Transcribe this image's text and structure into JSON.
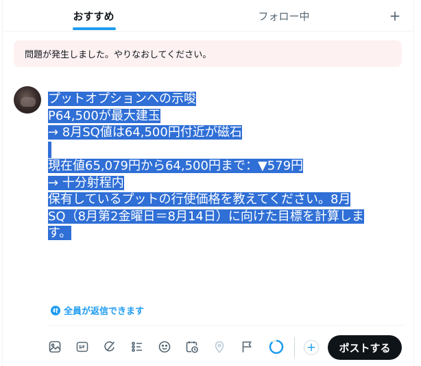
{
  "tabs": {
    "recommended": "おすすめ",
    "following": "フォロー中",
    "add_symbol": "+"
  },
  "error": {
    "message": "問題が発生しました。やりなおしてください。"
  },
  "composer": {
    "lines": [
      "プットオプションへの示唆",
      "P64,500が最大建玉",
      "→ 8月SQ値は64,500円付近が磁石",
      "",
      "現在値65,079円から64,500円まで：▼579円",
      "→ 十分射程内",
      "保有しているプットの行使価格を教えてください。8月",
      "SQ（8月第2金曜日＝8月14日）に向けた目標を計算しま",
      "す。"
    ]
  },
  "reply_setting": {
    "label": "全員が返信できます",
    "icon": "globe-icon"
  },
  "toolbar": {
    "icons": [
      "image-icon",
      "gif-icon",
      "grok-icon",
      "poll-icon",
      "emoji-icon",
      "schedule-icon",
      "location-icon",
      "flag-icon"
    ],
    "add_symbol": "+",
    "post_label": "ポストする"
  },
  "colors": {
    "accent": "#1d9bf0",
    "selection": "#2f6fd6",
    "error_bg": "#fdf1f2",
    "post_button": "#0f1419"
  }
}
